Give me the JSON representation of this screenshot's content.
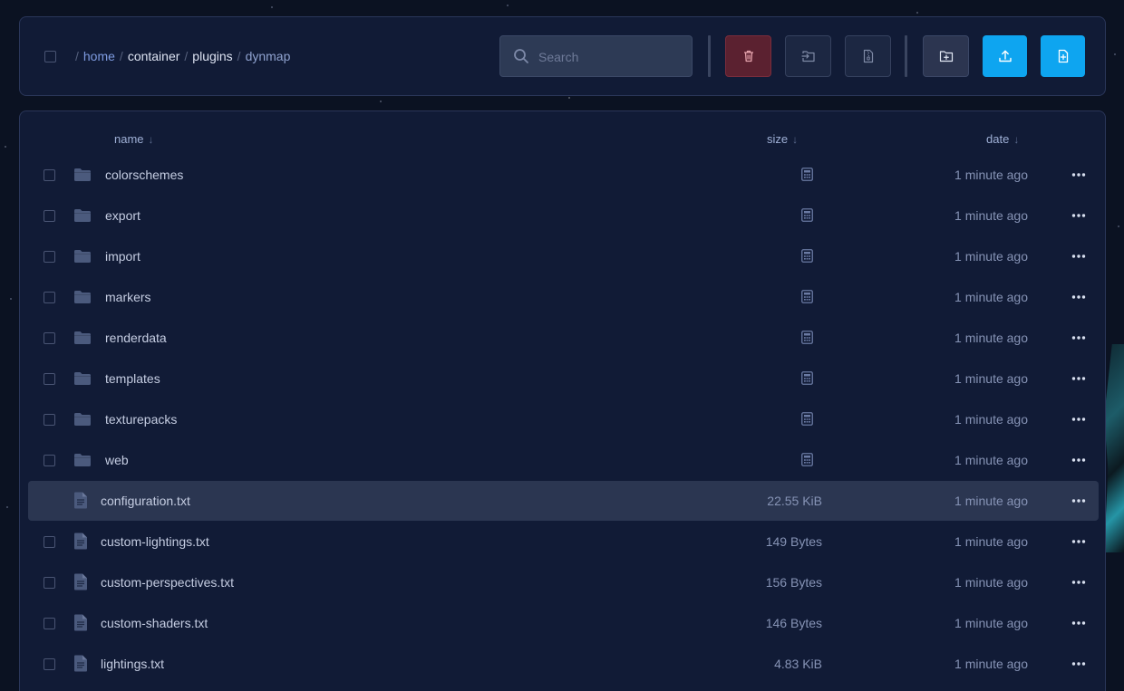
{
  "breadcrumb": {
    "separator": "/",
    "home": "home",
    "parts": [
      "container",
      "plugins"
    ],
    "current": "dynmap"
  },
  "search": {
    "placeholder": "Search",
    "value": ""
  },
  "toolbar": {
    "delete_icon": "trash-icon",
    "move_icon": "move-file-icon",
    "archive_icon": "archive-file-icon",
    "newfolder_icon": "folder-plus-icon",
    "upload_icon": "upload-icon",
    "newfile_icon": "file-plus-icon"
  },
  "colors": {
    "accent": "#0ea5f0",
    "danger": "#5b2130",
    "panel": "#111b36",
    "background": "#0b1222"
  },
  "table": {
    "columns": {
      "name": "name",
      "size": "size",
      "date": "date",
      "sort_arrow": "↓"
    },
    "rows": [
      {
        "type": "folder",
        "name": "colorschemes",
        "size": "",
        "date": "1 minute ago"
      },
      {
        "type": "folder",
        "name": "export",
        "size": "",
        "date": "1 minute ago"
      },
      {
        "type": "folder",
        "name": "import",
        "size": "",
        "date": "1 minute ago"
      },
      {
        "type": "folder",
        "name": "markers",
        "size": "",
        "date": "1 minute ago"
      },
      {
        "type": "folder",
        "name": "renderdata",
        "size": "",
        "date": "1 minute ago"
      },
      {
        "type": "folder",
        "name": "templates",
        "size": "",
        "date": "1 minute ago"
      },
      {
        "type": "folder",
        "name": "texturepacks",
        "size": "",
        "date": "1 minute ago"
      },
      {
        "type": "folder",
        "name": "web",
        "size": "",
        "date": "1 minute ago"
      },
      {
        "type": "file",
        "name": "configuration.txt",
        "size": "22.55 KiB",
        "date": "1 minute ago",
        "selected": true
      },
      {
        "type": "file",
        "name": "custom-lightings.txt",
        "size": "149 Bytes",
        "date": "1 minute ago"
      },
      {
        "type": "file",
        "name": "custom-perspectives.txt",
        "size": "156 Bytes",
        "date": "1 minute ago"
      },
      {
        "type": "file",
        "name": "custom-shaders.txt",
        "size": "146 Bytes",
        "date": "1 minute ago"
      },
      {
        "type": "file",
        "name": "lightings.txt",
        "size": "4.83 KiB",
        "date": "1 minute ago"
      }
    ]
  }
}
